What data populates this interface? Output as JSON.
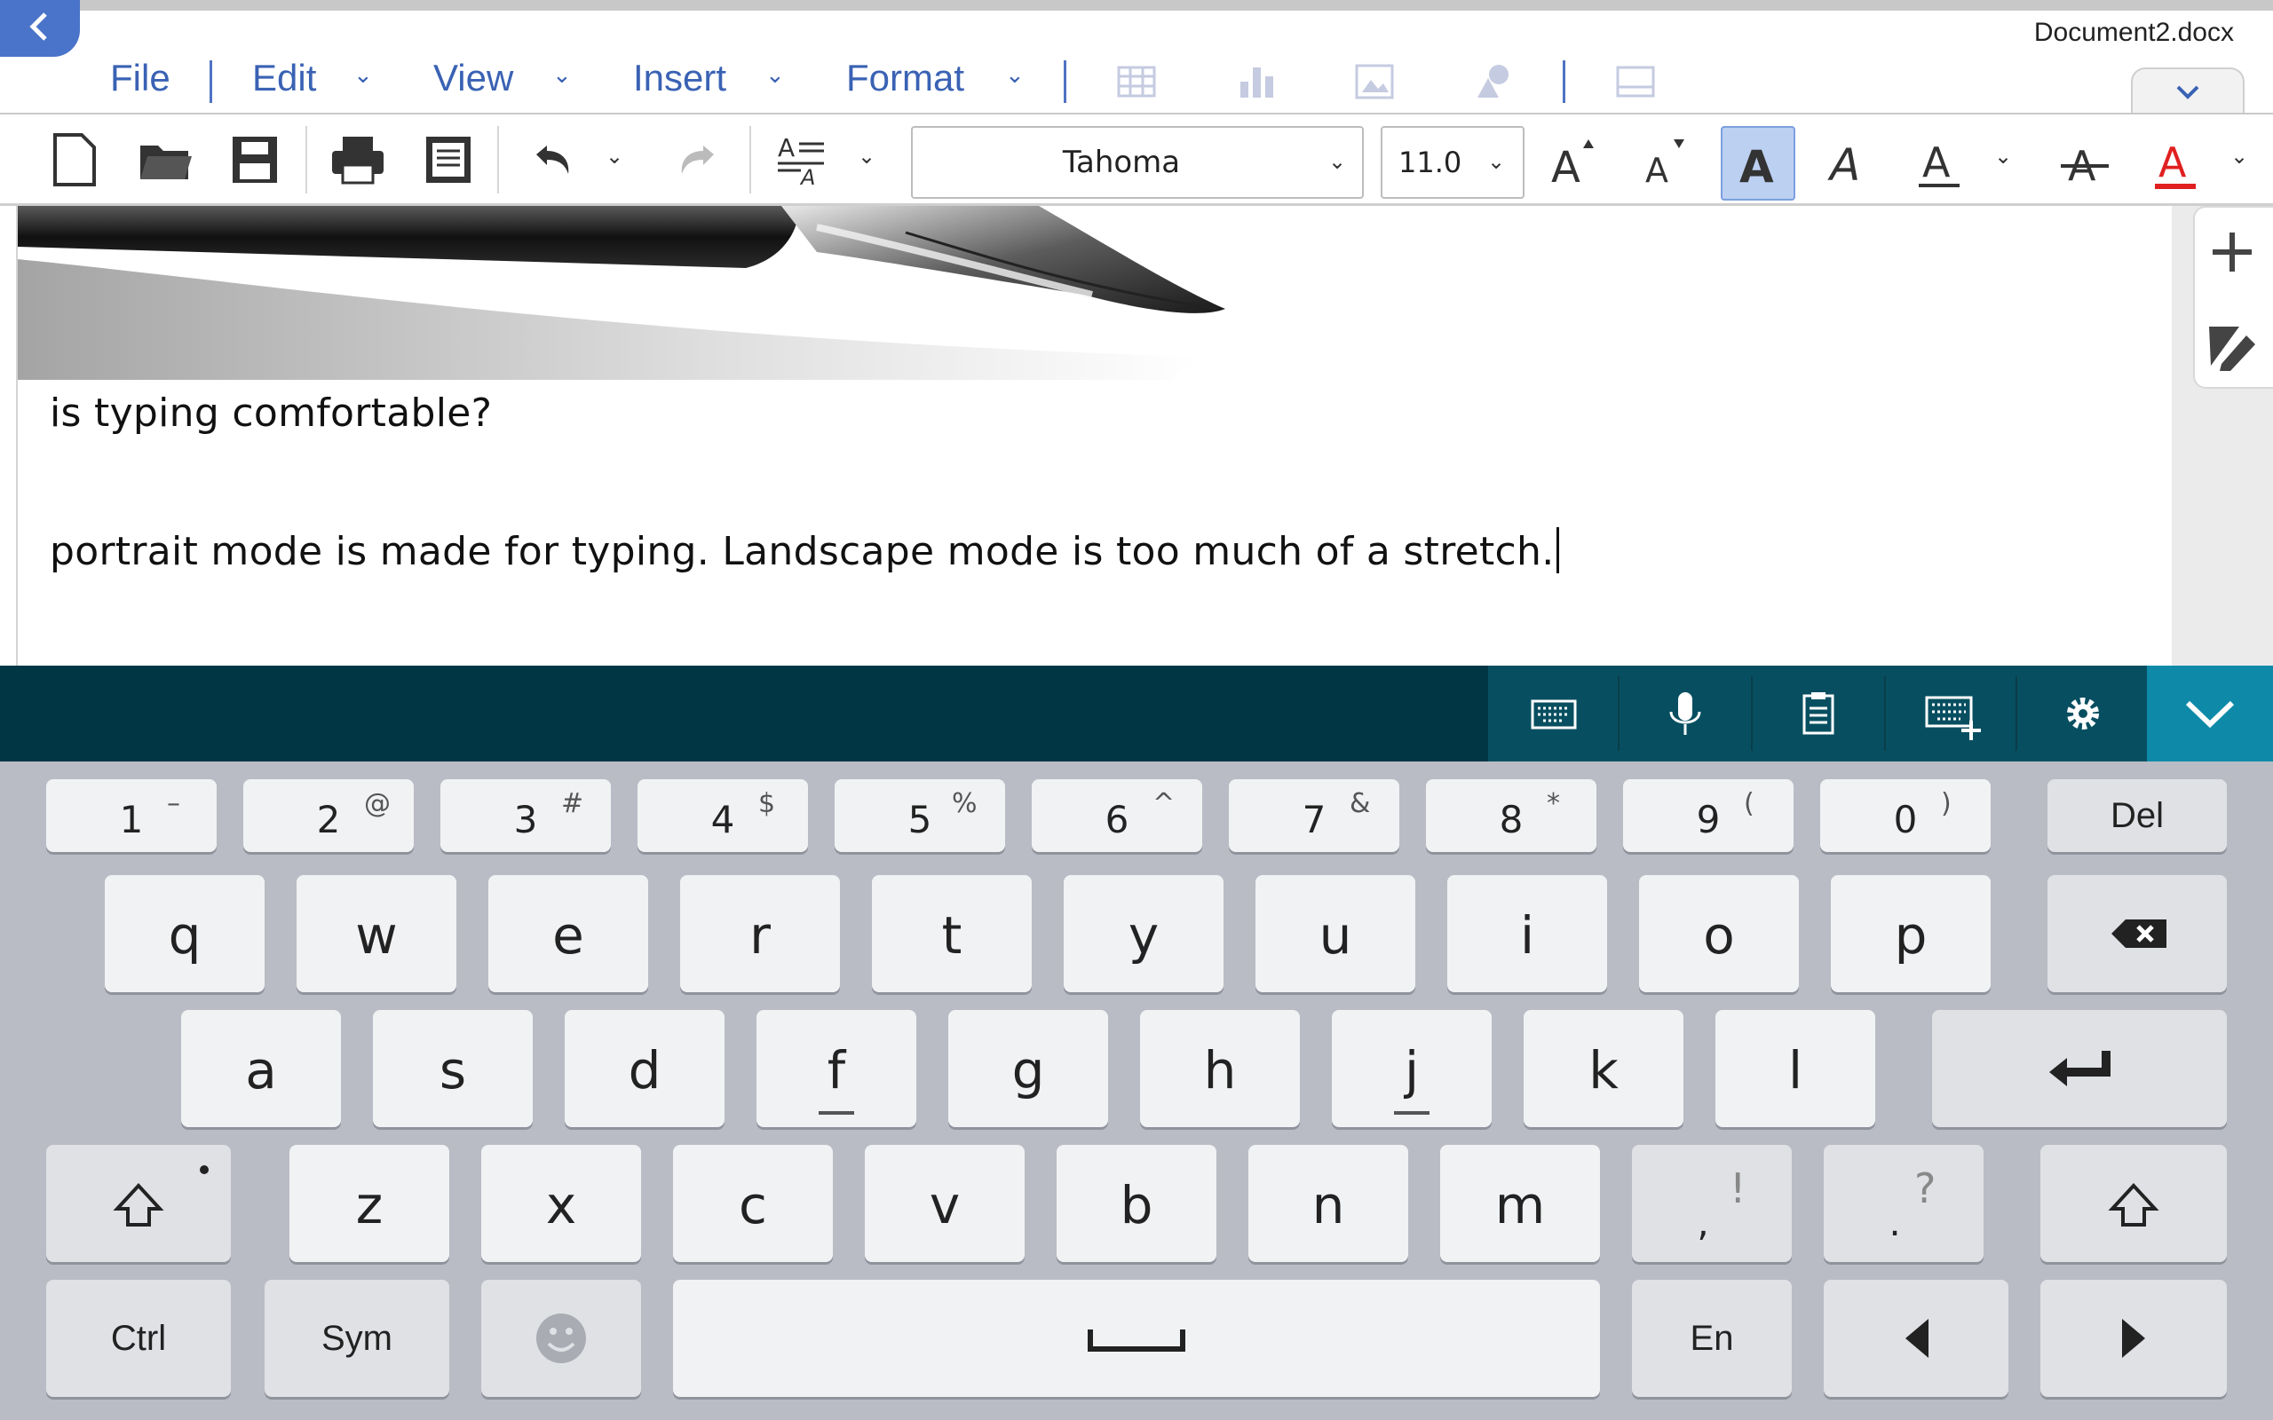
{
  "app": {
    "document_name": "Document2.docx",
    "back_icon": "chevron-left-icon"
  },
  "menu": {
    "items": [
      {
        "label": "File",
        "has_dropdown": false
      },
      {
        "label": "Edit",
        "has_dropdown": true
      },
      {
        "label": "View",
        "has_dropdown": true
      },
      {
        "label": "Insert",
        "has_dropdown": true
      },
      {
        "label": "Format",
        "has_dropdown": true
      }
    ],
    "disabled_icons": [
      "table-icon",
      "chart-icon",
      "image-icon",
      "shapes-icon",
      "textbox-icon"
    ],
    "collapse_icon": "chevron-down-icon"
  },
  "toolbar": {
    "icons": [
      "new-document-icon",
      "open-folder-icon",
      "save-icon",
      "print-icon",
      "page-view-icon",
      "undo-icon",
      "redo-icon",
      "text-style-icon"
    ],
    "font_name": "Tahoma",
    "font_size": "11.0",
    "format_buttons": [
      "increase-font-size",
      "decrease-font-size",
      "bold",
      "italic",
      "underline",
      "strikethrough",
      "font-color"
    ],
    "bold_active": true,
    "accent_color": "#3a62b4",
    "font_color": "#e02020"
  },
  "document": {
    "lines": [
      "is typing comfortable?",
      "portrait mode is made for typing. Landscape mode is too much of a stretch."
    ],
    "image": "fountain-pen-nib-image"
  },
  "side_rail": {
    "icons": [
      "add-icon",
      "pen-edit-icon"
    ]
  },
  "keyboard_bar": {
    "tools": [
      "keyboard-icon",
      "microphone-icon",
      "clipboard-icon",
      "keyboard-settings-icon",
      "gear-icon"
    ],
    "hide_icon": "chevron-down-icon",
    "bar_color": "#013644",
    "tool_color": "#074f60",
    "hide_color": "#0e8aa8"
  },
  "keyboard": {
    "number_row": [
      {
        "main": "1",
        "sub": "–"
      },
      {
        "main": "2",
        "sub": "@"
      },
      {
        "main": "3",
        "sub": "#"
      },
      {
        "main": "4",
        "sub": "$"
      },
      {
        "main": "5",
        "sub": "%"
      },
      {
        "main": "6",
        "sub": "^"
      },
      {
        "main": "7",
        "sub": "&"
      },
      {
        "main": "8",
        "sub": "*"
      },
      {
        "main": "9",
        "sub": "("
      },
      {
        "main": "0",
        "sub": ")"
      }
    ],
    "del_label": "Del",
    "row1": [
      "q",
      "w",
      "e",
      "r",
      "t",
      "y",
      "u",
      "i",
      "o",
      "p"
    ],
    "row2": [
      "a",
      "s",
      "d",
      "f",
      "g",
      "h",
      "j",
      "k",
      "l"
    ],
    "row3": [
      "z",
      "x",
      "c",
      "v",
      "b",
      "n",
      "m"
    ],
    "comma_key": {
      "main": ",",
      "sub": "!"
    },
    "period_key": {
      "main": ".",
      "sub": "?"
    },
    "ctrl_label": "Ctrl",
    "sym_label": "Sym",
    "lang_label": "En"
  }
}
